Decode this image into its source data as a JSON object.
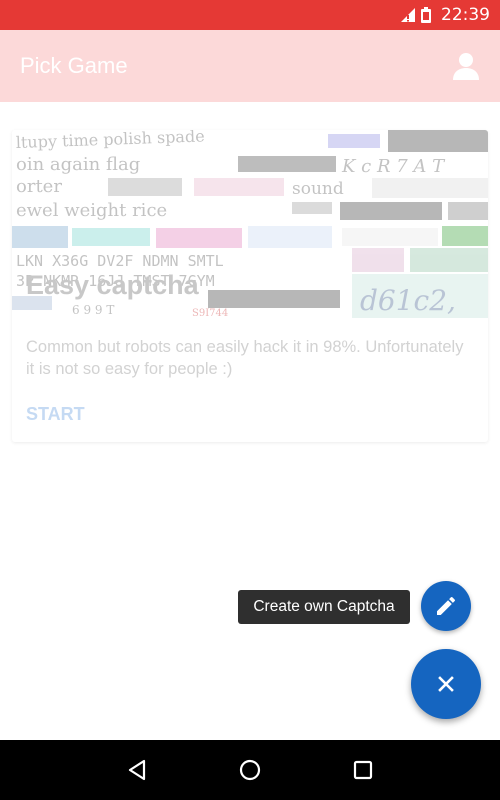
{
  "status_bar": {
    "time": "22:39",
    "bg_color": "#e53935"
  },
  "app_bar": {
    "title": "Pick Game",
    "bg_color": "#fcd9d9",
    "account_icon": "account-icon"
  },
  "card": {
    "title": "Easy captcha",
    "description": "Common but robots can easily hack it in 98%. Unfortunately it is not so easy for people :)",
    "start_label": "START",
    "image_icon": "captcha-collage-image"
  },
  "tooltip": {
    "label": "Create own Captcha"
  },
  "fab": {
    "mini_icon": "pencil-icon",
    "main_icon": "close-icon",
    "color": "#1565c0"
  },
  "nav": {
    "back": "back-icon",
    "home": "home-icon",
    "recents": "recents-icon"
  }
}
